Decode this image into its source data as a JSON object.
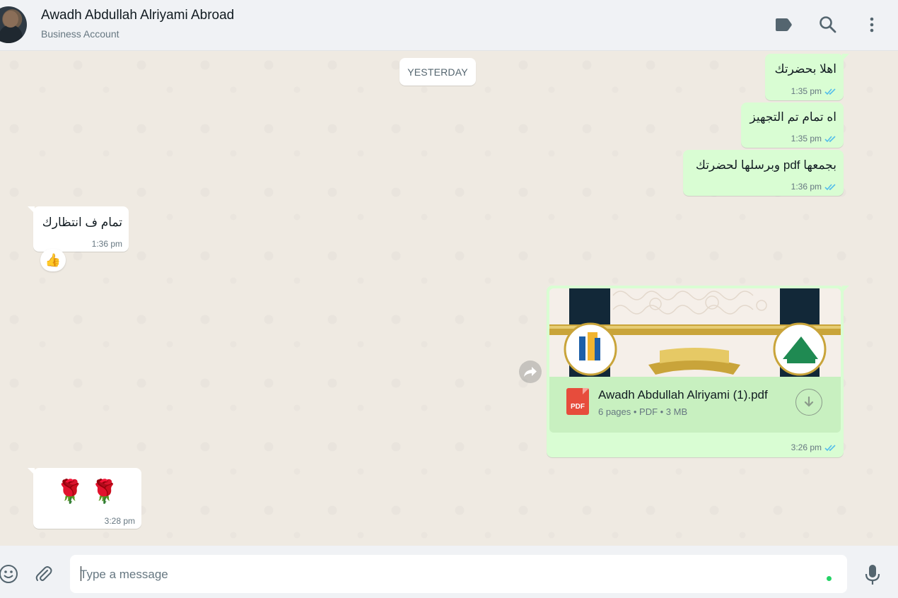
{
  "header": {
    "contact_name": "Awadh Abdullah Alriyami Abroad",
    "contact_subtitle": "Business Account"
  },
  "chat": {
    "date_divider": "YESTERDAY",
    "messages": [
      {
        "direction": "out",
        "text": "اهلا بحضرتك",
        "time": "1:35 pm"
      },
      {
        "direction": "out",
        "text": "اه تمام تم التجهيز",
        "time": "1:35 pm"
      },
      {
        "direction": "out",
        "text": "بجمعها pdf وبرسلها لحضرتك",
        "time": "1:36 pm"
      },
      {
        "direction": "in",
        "text": "تمام ف انتظارك",
        "time": "1:36 pm",
        "reaction": "👍"
      },
      {
        "direction": "out",
        "type": "document",
        "file_name": "Awadh Abdullah Alriyami (1).pdf",
        "file_info": "6 pages • PDF • 3 MB",
        "file_badge": "PDF",
        "time": "3:26 pm"
      },
      {
        "direction": "in",
        "text": "🌹 🌹",
        "time": "3:28 pm"
      }
    ]
  },
  "composer": {
    "placeholder": "Type a message"
  },
  "colors": {
    "outgoing_bubble": "#d9fdd3",
    "incoming_bubble": "#ffffff",
    "chat_background": "#efeae2",
    "ticks_blue": "#53bdeb"
  },
  "icons": [
    "label-icon",
    "search-icon",
    "menu-icon",
    "emoji-icon",
    "attach-icon",
    "mic-icon",
    "forward-icon",
    "download-icon",
    "pdf-icon",
    "double-check-icon"
  ]
}
